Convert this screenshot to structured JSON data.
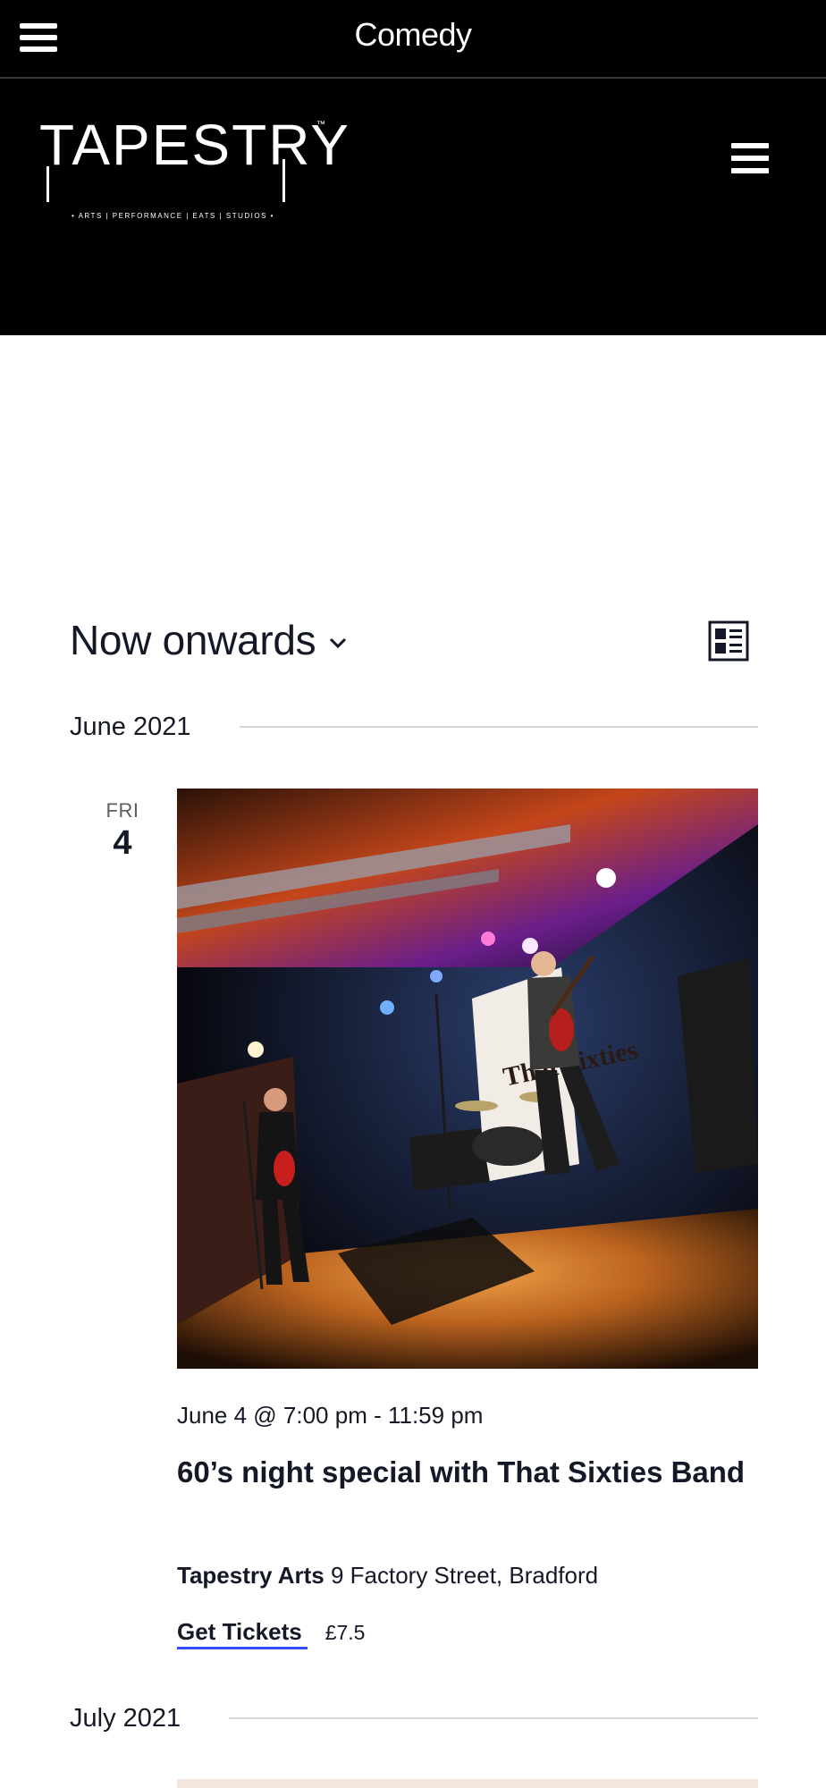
{
  "top_bar": {
    "title": "Comedy"
  },
  "header": {
    "logo": {
      "wordmark": "TAPESTRY",
      "trademark": "™",
      "tagline": "• ARTS | PERFORMANCE | EATS | STUDIOS •"
    }
  },
  "events_bar": {
    "range_label": "Now onwards"
  },
  "months": [
    {
      "label": "June 2021"
    },
    {
      "label": "July 2021"
    }
  ],
  "events": [
    {
      "day_of_week": "FRI",
      "day": "4",
      "time": "June 4 @ 7:00 pm - 11:59 pm",
      "title": "60’s night special with That Sixties Band",
      "venue_name": "Tapestry Arts",
      "venue_address": "9 Factory Street, Bradford",
      "tickets_label": "Get Tickets",
      "price": "£7.5",
      "image_banner_text": "That Sixties"
    }
  ],
  "colors": {
    "header_bg": "#000000",
    "text": "#141827",
    "ticket_underline": "#334aff",
    "rule": "#d5d5d5"
  },
  "icons": {
    "top_menu": "hamburger-icon",
    "site_menu": "hamburger-icon",
    "filter_dropdown": "chevron-down-icon",
    "view_toggle": "list-view-icon"
  }
}
